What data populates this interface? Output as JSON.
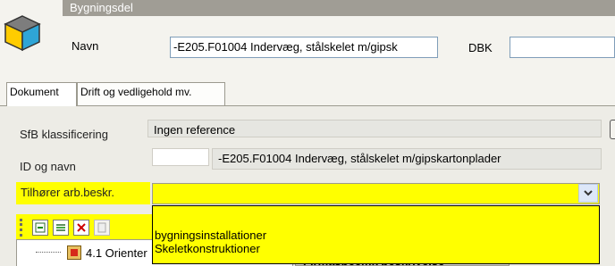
{
  "header": {
    "section_title": "Bygningsdel",
    "name_label": "Navn",
    "name_value": "-E205.F01004 Indervæg, stålskelet m/gipsk",
    "dbk_label": "DBK",
    "dbk_value": ""
  },
  "tabs": [
    {
      "label": "Dokument",
      "active": true
    },
    {
      "label": "Drift og vedligehold mv.",
      "active": false
    }
  ],
  "form": {
    "sfb_label": "SfB klassificering",
    "sfb_value": "Ingen reference",
    "id_label": "ID og navn",
    "id_value": "",
    "id_name_value": "-E205.F01004 Indervæg, stålskelet m/gipskartonplader",
    "belongs_label": "Tilhører arb.beskr.",
    "belongs_value": ""
  },
  "dropdown": {
    "options": [
      "bygningsinstallationer",
      "Skeletkonstruktioner"
    ]
  },
  "tree": {
    "item_label": "4.1 Orienter"
  },
  "partial": {
    "heading_text": "Firmaspecifik beskrivelse"
  },
  "icons": [
    "cube-logo-icon",
    "chevron-down-icon",
    "add-item-icon",
    "list-icon",
    "delete-icon",
    "document-icon",
    "folder-icon"
  ]
}
